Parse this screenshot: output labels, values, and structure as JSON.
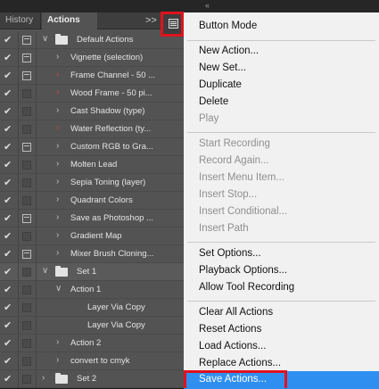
{
  "panel": {
    "tabs": [
      {
        "label": "History"
      },
      {
        "label": "Actions"
      }
    ],
    "expand_glyph": ">>",
    "menu_glyph": "panel-menu-icon",
    "rows": [
      {
        "label": "Default Actions",
        "type": "set",
        "expanded": true,
        "checked": true,
        "dialog": true
      },
      {
        "label": "Vignette (selection)",
        "type": "action",
        "checked": true,
        "dialog": true
      },
      {
        "label": "Frame Channel - 50 ...",
        "type": "action",
        "checked": true,
        "dialog": true
      },
      {
        "label": "Wood Frame - 50 pi...",
        "type": "action",
        "checked": true,
        "dialog": false
      },
      {
        "label": "Cast Shadow (type)",
        "type": "action",
        "checked": true,
        "dialog": false
      },
      {
        "label": "Water Reflection (ty...",
        "type": "action",
        "checked": true,
        "dialog": false
      },
      {
        "label": "Custom RGB to Gra...",
        "type": "action",
        "checked": true,
        "dialog": true
      },
      {
        "label": "Molten Lead",
        "type": "action",
        "checked": true,
        "dialog": false
      },
      {
        "label": "Sepia Toning (layer)",
        "type": "action",
        "checked": true,
        "dialog": false
      },
      {
        "label": "Quadrant Colors",
        "type": "action",
        "checked": true,
        "dialog": false
      },
      {
        "label": "Save as Photoshop ...",
        "type": "action",
        "checked": true,
        "dialog": true
      },
      {
        "label": "Gradient Map",
        "type": "action",
        "checked": true,
        "dialog": false
      },
      {
        "label": "Mixer Brush Cloning...",
        "type": "action",
        "checked": true,
        "dialog": true
      },
      {
        "label": "Set 1",
        "type": "set",
        "expanded": true,
        "checked": true,
        "dialog": false
      },
      {
        "label": "Action 1",
        "type": "action",
        "expanded": true,
        "checked": true,
        "dialog": false
      },
      {
        "label": "Layer Via Copy",
        "type": "command",
        "checked": true,
        "dialog": false
      },
      {
        "label": "Layer Via Copy",
        "type": "command",
        "checked": true,
        "dialog": false
      },
      {
        "label": "Action 2",
        "type": "action",
        "checked": true,
        "dialog": false
      },
      {
        "label": "convert to cmyk",
        "type": "action",
        "checked": true,
        "dialog": false
      },
      {
        "label": "Set 2",
        "type": "set",
        "expanded": false,
        "checked": true,
        "dialog": false
      }
    ]
  },
  "menu": {
    "items": [
      {
        "label": "Button Mode",
        "enabled": true
      },
      {
        "label": "New Action...",
        "enabled": true
      },
      {
        "label": "New Set...",
        "enabled": true
      },
      {
        "label": "Duplicate",
        "enabled": true
      },
      {
        "label": "Delete",
        "enabled": true
      },
      {
        "label": "Play",
        "enabled": false
      },
      {
        "label": "Start Recording",
        "enabled": false
      },
      {
        "label": "Record Again...",
        "enabled": false
      },
      {
        "label": "Insert Menu Item...",
        "enabled": false
      },
      {
        "label": "Insert Stop...",
        "enabled": false
      },
      {
        "label": "Insert Conditional...",
        "enabled": false
      },
      {
        "label": "Insert Path",
        "enabled": false
      },
      {
        "label": "Set Options...",
        "enabled": true
      },
      {
        "label": "Playback Options...",
        "enabled": true
      },
      {
        "label": "Allow Tool Recording",
        "enabled": true
      },
      {
        "label": "Clear All Actions",
        "enabled": true
      },
      {
        "label": "Reset Actions",
        "enabled": true
      },
      {
        "label": "Load Actions...",
        "enabled": true
      },
      {
        "label": "Replace Actions...",
        "enabled": true
      },
      {
        "label": "Save Actions...",
        "enabled": true,
        "highlighted": true
      }
    ]
  },
  "colors": {
    "highlight": "#2f8ff0",
    "annotation_red": "#e0121f"
  }
}
